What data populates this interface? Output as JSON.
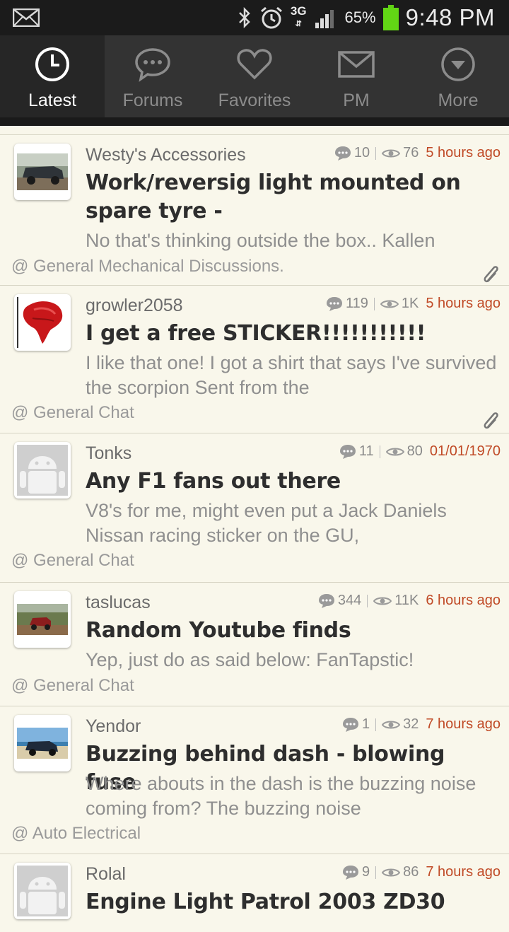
{
  "status_bar": {
    "battery": "65%",
    "time": "9:48 PM",
    "network": "3G"
  },
  "tabs": [
    {
      "label": "Latest",
      "icon": "clock-icon",
      "active": true
    },
    {
      "label": "Forums",
      "icon": "chat-bubble-icon",
      "active": false
    },
    {
      "label": "Favorites",
      "icon": "heart-icon",
      "active": false
    },
    {
      "label": "PM",
      "icon": "envelope-icon",
      "active": false
    },
    {
      "label": "More",
      "icon": "dropdown-circle-icon",
      "active": false
    }
  ],
  "topics": [
    {
      "author": "Westy's Accessories",
      "replies": "10",
      "views": "76",
      "time": "5 hours ago",
      "title": "Work/reversig light mounted on spare tyre -",
      "excerpt": "No that's thinking outside the box.. Kallen",
      "forum": "@ General Mechanical Discussions.",
      "attachment": true,
      "avatar": "truck-photo"
    },
    {
      "author": "growler2058",
      "replies": "119",
      "views": "1K",
      "time": "5 hours ago",
      "title": "I get a free STICKER!!!!!!!!!!!",
      "excerpt": "I like that one! I got a shirt that says I've survived the scorpion Sent from the",
      "forum": "@ General Chat",
      "attachment": true,
      "avatar": "red-pepper"
    },
    {
      "author": "Tonks",
      "replies": "11",
      "views": "80",
      "time": "01/01/1970",
      "title": "Any F1 fans out there",
      "excerpt": "V8's for me, might even put a Jack Daniels Nissan racing sticker on the GU,",
      "forum": "@ General Chat",
      "attachment": false,
      "avatar": "android-default"
    },
    {
      "author": "taslucas",
      "replies": "344",
      "views": "11K",
      "time": "6 hours ago",
      "title": "Random Youtube finds",
      "excerpt": "Yep, just do as said below: FanTapstic!",
      "forum": "@ General Chat",
      "attachment": false,
      "avatar": "offroad-photo"
    },
    {
      "author": "Yendor",
      "replies": "1",
      "views": "32",
      "time": "7 hours ago",
      "title": "Buzzing behind dash - blowing fuse",
      "excerpt": "Where abouts in the dash is the buzzing noise coming from? The buzzing noise",
      "forum": "@ Auto Electrical",
      "attachment": false,
      "avatar": "beach-4wd-photo"
    },
    {
      "author": "Rolal",
      "replies": "9",
      "views": "86",
      "time": "7 hours ago",
      "title": "Engine Light Patrol 2003 ZD30",
      "excerpt": "",
      "forum": "",
      "attachment": false,
      "avatar": "android-default"
    }
  ]
}
